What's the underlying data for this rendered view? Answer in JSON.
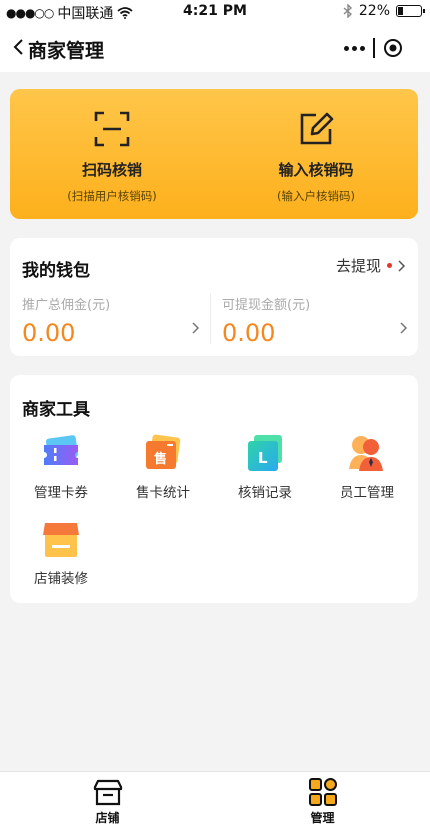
{
  "status_bar": {
    "carrier": "中国联通",
    "time": "4:21 PM",
    "battery": "22%",
    "battery_level": 0.22
  },
  "nav": {
    "title": "商家管理"
  },
  "scan": [
    {
      "label": "扫码核销",
      "sub": "(扫描用户核销码)",
      "icon": "scan-icon"
    },
    {
      "label": "输入核销码",
      "sub": "(输入户核销码)",
      "icon": "edit-icon"
    }
  ],
  "wallet": {
    "title": "我的钱包",
    "withdraw": "去提现",
    "items": [
      {
        "caption": "推广总佣金(元)",
        "amount": "0.00"
      },
      {
        "caption": "可提现金额(元)",
        "amount": "0.00"
      }
    ]
  },
  "tools": {
    "title": "商家工具",
    "items": [
      {
        "label": "管理卡券",
        "icon": "coupon-icon"
      },
      {
        "label": "售卡统计",
        "icon": "sell-card-icon",
        "badge": "售"
      },
      {
        "label": "核销记录",
        "icon": "record-icon",
        "badge": "L"
      },
      {
        "label": "员工管理",
        "icon": "staff-icon"
      },
      {
        "label": "店铺装修",
        "icon": "shop-decor-icon"
      }
    ]
  },
  "tabbar": [
    {
      "label": "店铺",
      "icon": "store-icon"
    },
    {
      "label": "管理",
      "icon": "grid-icon"
    }
  ],
  "colors": {
    "accent": "#fdb01c",
    "amount": "#f5871f",
    "dot": "#e8322c"
  }
}
